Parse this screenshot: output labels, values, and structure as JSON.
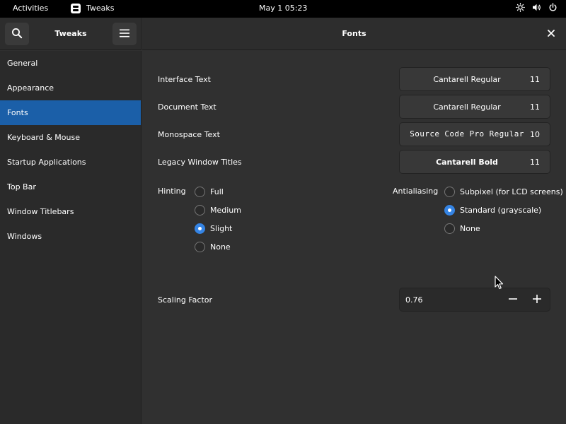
{
  "topbar": {
    "activities": "Activities",
    "app_name": "Tweaks",
    "clock": "May 1  05:23",
    "icons": [
      "brightness-icon",
      "volume-icon",
      "power-icon"
    ]
  },
  "window": {
    "sidebar_title": "Tweaks",
    "page_title": "Fonts",
    "header_icons": [
      "search-icon",
      "hamburger-menu-icon",
      "close-icon"
    ]
  },
  "sidebar": {
    "items": [
      {
        "label": "General",
        "selected": false
      },
      {
        "label": "Appearance",
        "selected": false
      },
      {
        "label": "Fonts",
        "selected": true
      },
      {
        "label": "Keyboard & Mouse",
        "selected": false
      },
      {
        "label": "Startup Applications",
        "selected": false
      },
      {
        "label": "Top Bar",
        "selected": false
      },
      {
        "label": "Window Titlebars",
        "selected": false
      },
      {
        "label": "Windows",
        "selected": false
      }
    ]
  },
  "fonts": {
    "interface": {
      "label": "Interface Text",
      "font": "Cantarell Regular",
      "size": "11"
    },
    "document": {
      "label": "Document Text",
      "font": "Cantarell Regular",
      "size": "11"
    },
    "monospace": {
      "label": "Monospace Text",
      "font": "Source Code Pro Regular",
      "size": "10"
    },
    "legacy": {
      "label": "Legacy Window Titles",
      "font": "Cantarell Bold",
      "size": "11"
    }
  },
  "hinting": {
    "label": "Hinting",
    "options": [
      "Full",
      "Medium",
      "Slight",
      "None"
    ],
    "selected": "Slight"
  },
  "antialiasing": {
    "label": "Antialiasing",
    "options": [
      "Subpixel (for LCD screens)",
      "Standard (grayscale)",
      "None"
    ],
    "selected": "Standard (grayscale)"
  },
  "scaling": {
    "label": "Scaling Factor",
    "value": "0.76"
  },
  "colors": {
    "accent": "#3584e4",
    "selection": "#1b5fa8",
    "background": "#303030",
    "sidebar": "#2a2a2a"
  }
}
